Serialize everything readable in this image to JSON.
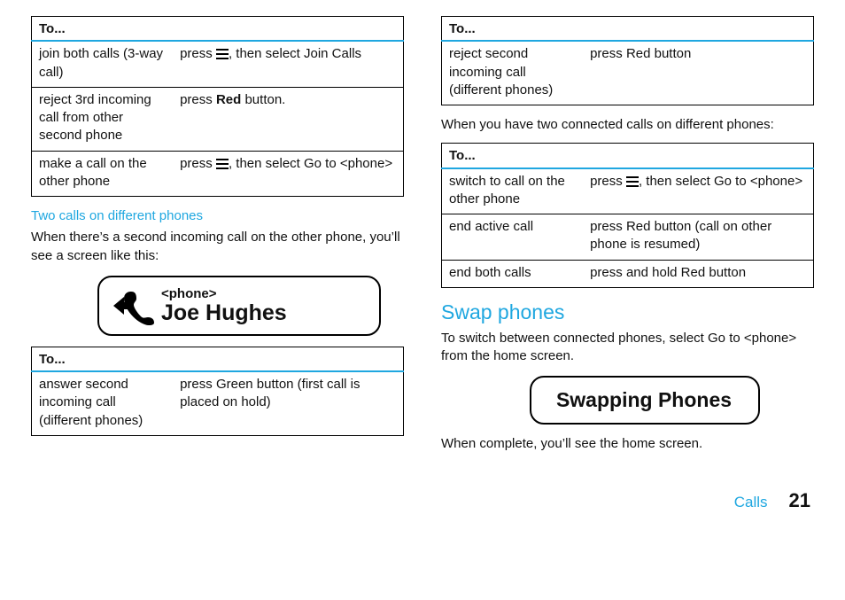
{
  "headers": {
    "to": "To..."
  },
  "table1": {
    "rows": [
      {
        "act": "join both calls (3‑way call)",
        "do_pre": "press  ",
        "do_icon": true,
        "do_post": ", then select Join Calls"
      },
      {
        "act": "reject 3rd incoming call from other second phone",
        "do_pre": "press ",
        "do_bold": "Red",
        "do_post": " button."
      },
      {
        "act": "make a call on the other phone",
        "do_pre": "press  ",
        "do_icon": true,
        "do_post": ", then select Go to <phone>"
      }
    ]
  },
  "sec_two_calls": {
    "heading": "Two calls on different phones",
    "intro": "When there’s a second incoming call on the other phone, you’ll see a screen like this:"
  },
  "screen1": {
    "label": "<phone>",
    "caller": "Joe Hughes"
  },
  "table2": {
    "rows": [
      {
        "act": "answer second incoming call (different phones)",
        "do": "press Green button (first call is placed on hold)"
      }
    ]
  },
  "table3": {
    "rows": [
      {
        "act": "reject second incoming call (different phones)",
        "do": "press Red button"
      }
    ]
  },
  "intro3": "When you have two connected calls on different phones:",
  "table4": {
    "rows": [
      {
        "act": "switch to call on the other phone",
        "do_pre": "press  ",
        "do_icon": true,
        "do_post": ", then select Go to <phone>"
      },
      {
        "act": "end active call",
        "do": "press Red button (call on other phone is resumed)"
      },
      {
        "act": "end both calls",
        "do": "press and hold Red button"
      }
    ]
  },
  "swap": {
    "heading": "Swap phones",
    "intro": "To switch between connected phones, select Go to <phone> from the home screen.",
    "screen": "Swapping Phones",
    "outro": "When complete, you’ll see the home screen."
  },
  "footer": {
    "chapter": "Calls",
    "page": "21"
  }
}
